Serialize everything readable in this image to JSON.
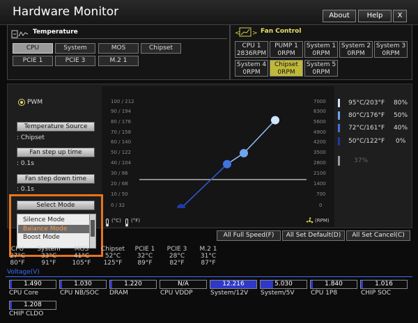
{
  "app": {
    "title": "Hardware Monitor",
    "about": "About",
    "help": "Help",
    "close": "X"
  },
  "temperature": {
    "heading": "Temperature",
    "tabs": [
      "CPU",
      "System",
      "MOS",
      "Chipset",
      "PCIE 1",
      "PCIE 3",
      "M.2 1"
    ],
    "selected": "CPU"
  },
  "fan_control": {
    "heading": "Fan Control",
    "fans": [
      {
        "name": "CPU 1",
        "rpm": "2836RPM"
      },
      {
        "name": "PUMP 1",
        "rpm": "0RPM"
      },
      {
        "name": "System 1",
        "rpm": "0RPM"
      },
      {
        "name": "System 2",
        "rpm": "0RPM"
      },
      {
        "name": "System 3",
        "rpm": "0RPM"
      },
      {
        "name": "System 4",
        "rpm": "0RPM"
      },
      {
        "name": "Chipset",
        "rpm": "0RPM"
      },
      {
        "name": "System 5",
        "rpm": "0RPM"
      }
    ],
    "selected": "Chipset"
  },
  "left_panel": {
    "pwm_label": "PWM",
    "temp_source_btn": "Temperature Source",
    "temp_source_value": ": Chipset",
    "step_up_btn": "Fan step up time",
    "step_up_value": ": 0.1s",
    "step_down_btn": "Fan step down time",
    "step_down_value": ": 0.1s",
    "select_mode_btn": "Select Mode",
    "modes": [
      "Silence Mode",
      "Balance Mode",
      "Boost Mode"
    ],
    "selected_mode": "Balance Mode"
  },
  "chart": {
    "temp_ticks": [
      "100 / 212",
      "90 / 194",
      "80 / 176",
      "70 / 158",
      "60 / 140",
      "50 / 122",
      "40 / 104",
      "30 / 86",
      "20 / 68",
      "10 / 50",
      "0 / 32"
    ],
    "rpm_ticks": [
      "7000",
      "6300",
      "5600",
      "4900",
      "4200",
      "3500",
      "2800",
      "2100",
      "1400",
      "700",
      "0"
    ],
    "unit_c": "(°C)",
    "unit_f": "(°F)",
    "unit_rpm": "(RPM)"
  },
  "chart_data": {
    "type": "line",
    "title": "",
    "xlabel": "",
    "ylabel": "",
    "y_left_ticks": [
      "0 / 32",
      "10 / 50",
      "20 / 68",
      "30 / 86",
      "40 / 104",
      "50 / 122",
      "60 / 140",
      "70 / 158",
      "80 / 176",
      "90 / 194",
      "100 / 212"
    ],
    "y_right_ticks": [
      0,
      700,
      1400,
      2100,
      2800,
      3500,
      4200,
      4900,
      5600,
      6300,
      7000
    ],
    "ylim": [
      0,
      100
    ],
    "series": [
      {
        "points": [
          {
            "temp_c": 50,
            "duty_pct": 0
          },
          {
            "temp_c": 72,
            "duty_pct": 40
          },
          {
            "temp_c": 80,
            "duty_pct": 50
          },
          {
            "temp_c": 95,
            "duty_pct": 80
          }
        ]
      }
    ],
    "current_line_pct": 26
  },
  "legend": [
    {
      "temp": "95°C/203°F",
      "pct": "80%",
      "color": "#cfe6ff"
    },
    {
      "temp": "80°C/176°F",
      "pct": "50%",
      "color": "#6fa4f0"
    },
    {
      "temp": "72°C/161°F",
      "pct": "40%",
      "color": "#3f74e0"
    },
    {
      "temp": "50°C/122°F",
      "pct": "0%",
      "color": "#1f3aa8"
    }
  ],
  "fan_idle_pct": "37%",
  "actions": {
    "full_speed": "All Full Speed(F)",
    "set_default": "All Set Default(D)",
    "set_cancel": "All Set Cancel(C)"
  },
  "temps_bottom": [
    {
      "name": "CPU",
      "c": "27°C",
      "f": "80°F"
    },
    {
      "name": "System",
      "c": "33°C",
      "f": "91°F"
    },
    {
      "name": "MOS",
      "c": "41°C",
      "f": "105°F"
    },
    {
      "name": "Chipset",
      "c": "52°C",
      "f": "125°F"
    },
    {
      "name": "PCIE 1",
      "c": "32°C",
      "f": "89°F"
    },
    {
      "name": "PCIE 3",
      "c": "28°C",
      "f": "82°F"
    },
    {
      "name": "M.2 1",
      "c": "31°C",
      "f": "87°F"
    }
  ],
  "voltage": {
    "heading": "Voltage(V)",
    "items": [
      {
        "label": "CPU Core",
        "value": "1.490",
        "fill": 0.05
      },
      {
        "label": "CPU NB/SOC",
        "value": "1.030",
        "fill": 0.05
      },
      {
        "label": "DRAM",
        "value": "1.220",
        "fill": 0.05
      },
      {
        "label": "CPU VDDP",
        "value": "N/A",
        "fill": 0
      },
      {
        "label": "System/12V",
        "value": "12.216",
        "fill": 1.0
      },
      {
        "label": "System/5V",
        "value": "5.030",
        "fill": 0.28
      },
      {
        "label": "CPU 1P8",
        "value": "1.840",
        "fill": 0.05
      },
      {
        "label": "CHIP SOC",
        "value": "1.016",
        "fill": 0.05
      },
      {
        "label": "CHIP CLDO",
        "value": "1.208",
        "fill": 0.05
      }
    ]
  },
  "colors": {
    "highlight_box": "#e8741e",
    "curve": "#8fc3ff",
    "voltage_heading": "#3b6cff"
  }
}
